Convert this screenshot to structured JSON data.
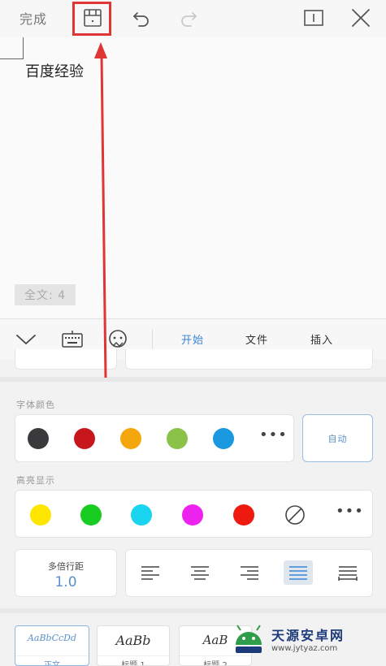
{
  "toolbar": {
    "done_label": "完成",
    "icons": [
      "save-icon",
      "undo-icon",
      "redo-icon",
      "reading-mode-icon",
      "close-icon"
    ]
  },
  "document": {
    "text": "百度经验",
    "word_count": "全文: 4"
  },
  "tabs": {
    "icons": [
      "collapse-chevron-icon",
      "keyboard-icon",
      "voice-assistant-icon"
    ],
    "items": [
      {
        "label": "开始",
        "active": true
      },
      {
        "label": "文件",
        "active": false
      },
      {
        "label": "插入",
        "active": false
      }
    ]
  },
  "font_color": {
    "label": "字体颜色",
    "swatches": [
      "#3a3a3c",
      "#c8161d",
      "#f4a70c",
      "#8bc34a",
      "#1a98e0"
    ],
    "auto_label": "自动"
  },
  "highlight": {
    "label": "高亮显示",
    "swatches": [
      "#ffe600",
      "#18cc22",
      "#19d4ee",
      "#ee22ee",
      "#ee1a10"
    ]
  },
  "paragraph": {
    "line_spacing_label": "多倍行距",
    "line_spacing_value": "1.0",
    "alignments": [
      "align-left",
      "align-center",
      "align-right",
      "align-justify",
      "align-distributed"
    ],
    "active_alignment": "align-justify"
  },
  "styles": [
    {
      "sample": "AaBbCcDd",
      "name": "正文",
      "active": true
    },
    {
      "sample": "AaBb",
      "name": "标题 1",
      "active": false
    },
    {
      "sample": "AaB",
      "name": "标题 2",
      "active": false
    }
  ],
  "watermark": {
    "title": "天源安卓网",
    "url": "www.jytyaz.com"
  },
  "colors": {
    "accent": "#3a86d6",
    "annotation": "#e03535"
  }
}
